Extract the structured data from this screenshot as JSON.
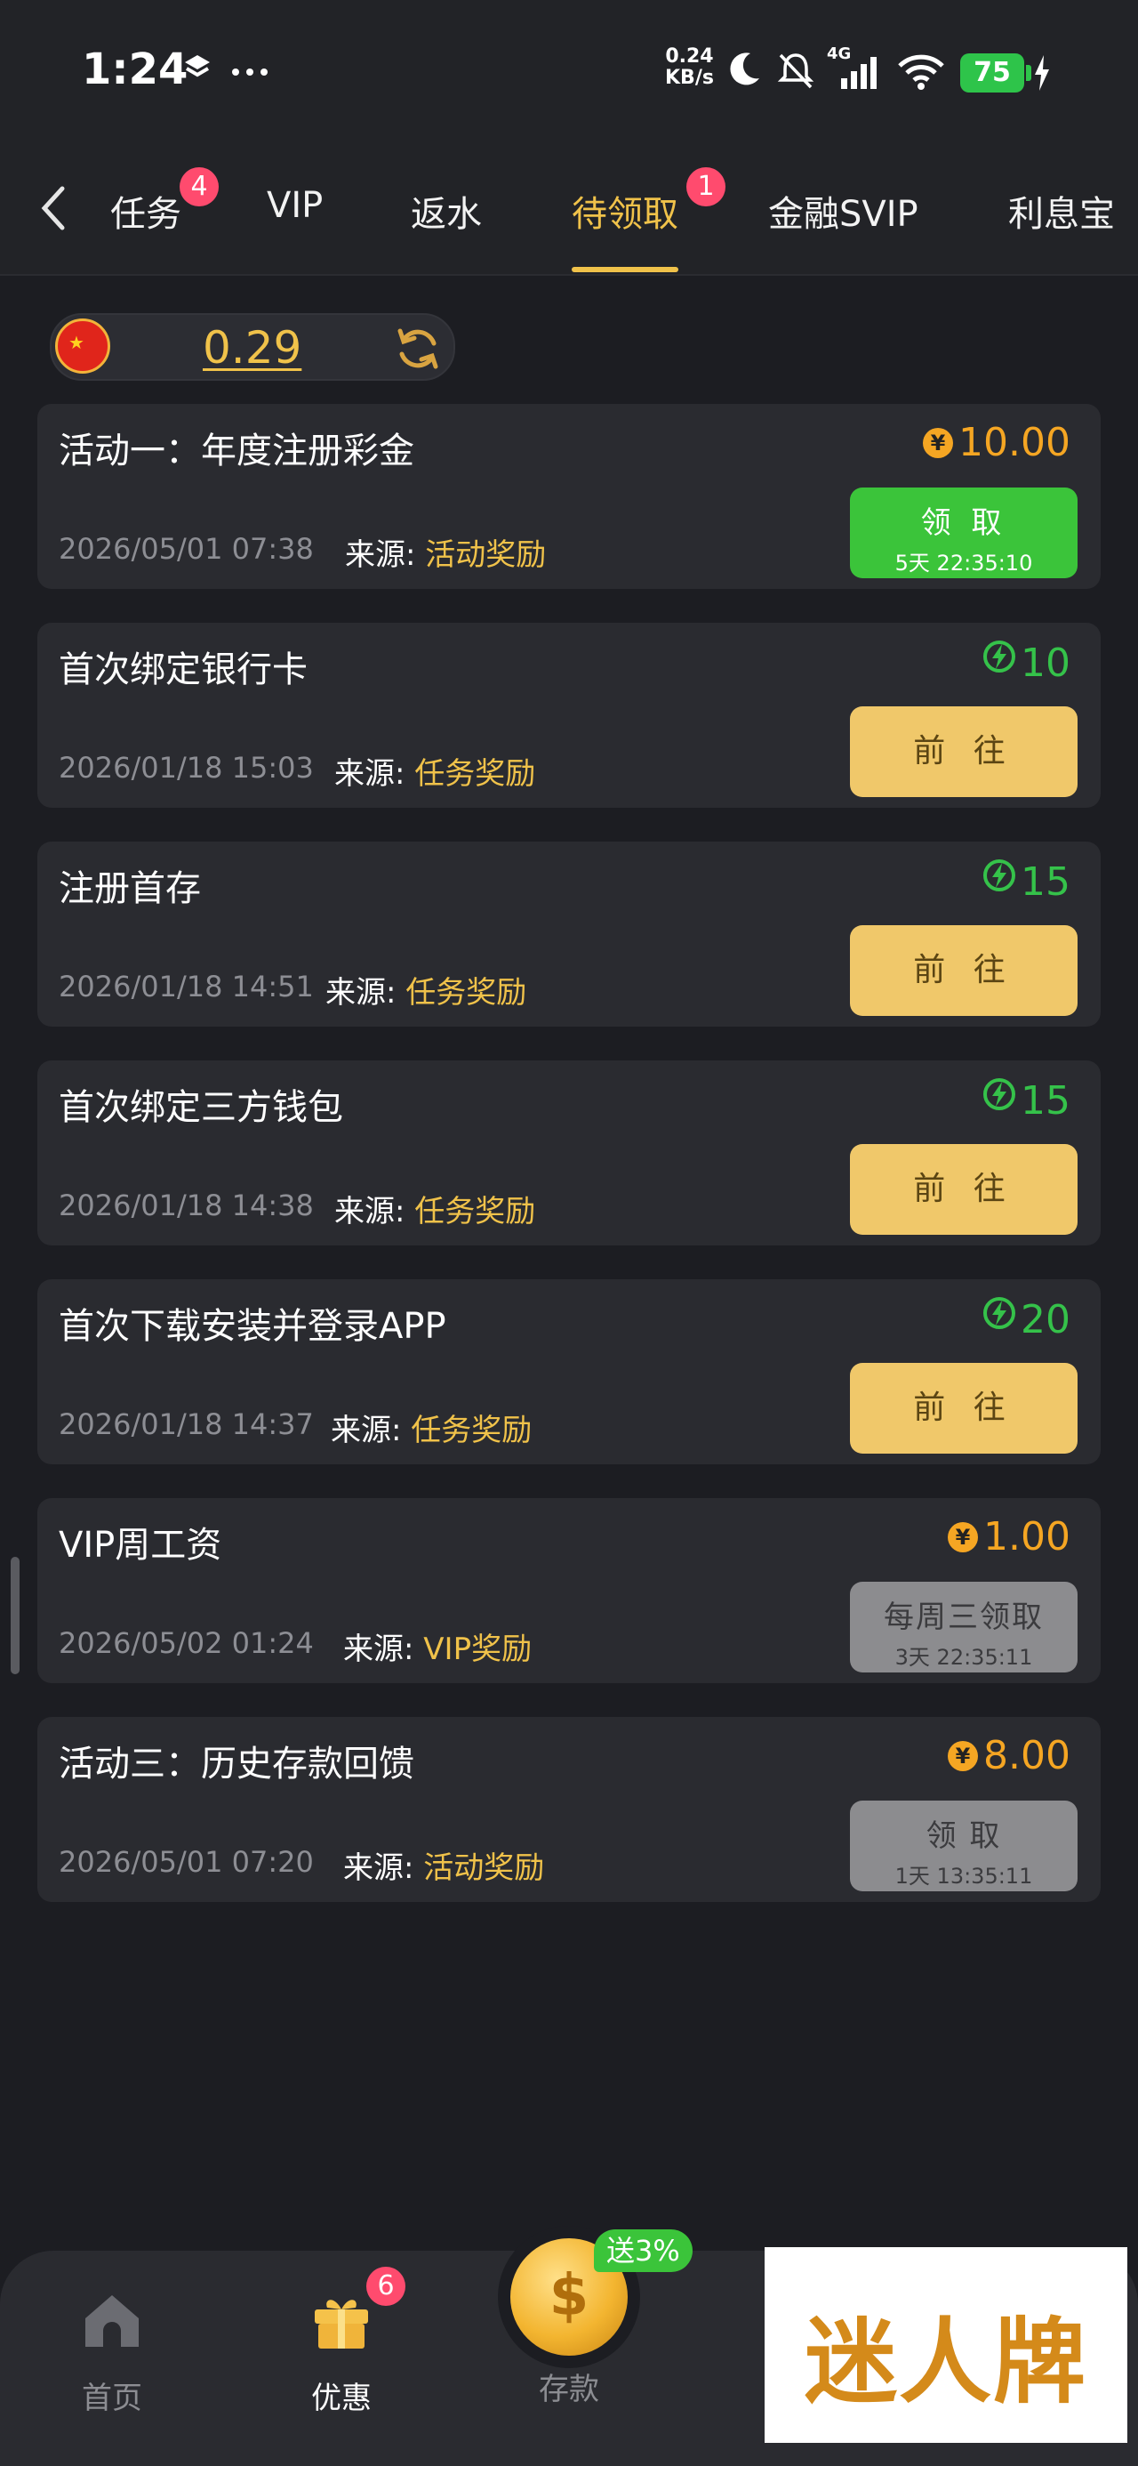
{
  "status_bar": {
    "time": "1:24",
    "net_speed_value": "0.24",
    "net_speed_unit": "KB/s",
    "signal_type": "4G",
    "battery": "75"
  },
  "tabs": [
    {
      "label": "任务",
      "badge": "4"
    },
    {
      "label": "VIP"
    },
    {
      "label": "返水"
    },
    {
      "label": "待领取",
      "badge": "1",
      "active": true
    },
    {
      "label": "金融SVIP"
    },
    {
      "label": "利息宝"
    }
  ],
  "balance": {
    "value": "0.29"
  },
  "items": [
    {
      "title": "活动一：年度注册彩金",
      "amount": "10.00",
      "amount_kind": "coin",
      "date": "2026/05/01 07:38",
      "source_label": "来源:",
      "source": "活动奖励",
      "button": {
        "kind": "claim",
        "label": "领 取",
        "sub": "5天 22:35:10"
      }
    },
    {
      "title": "首次绑定银行卡",
      "amount": "10",
      "amount_kind": "bolt",
      "date": "2026/01/18 15:03",
      "source_label": "来源:",
      "source": "任务奖励",
      "button": {
        "kind": "go",
        "label": "前 往"
      }
    },
    {
      "title": "注册首存",
      "amount": "15",
      "amount_kind": "bolt",
      "date": "2026/01/18 14:51",
      "source_label": "来源:",
      "source": "任务奖励",
      "button": {
        "kind": "go",
        "label": "前 往"
      }
    },
    {
      "title": "首次绑定三方钱包",
      "amount": "15",
      "amount_kind": "bolt",
      "date": "2026/01/18 14:38",
      "source_label": "来源:",
      "source": "任务奖励",
      "button": {
        "kind": "go",
        "label": "前 往"
      }
    },
    {
      "title": "首次下载安装并登录APP",
      "amount": "20",
      "amount_kind": "bolt",
      "date": "2026/01/18 14:37",
      "source_label": "来源:",
      "source": "任务奖励",
      "button": {
        "kind": "go",
        "label": "前 往"
      }
    },
    {
      "title": "VIP周工资",
      "amount": "1.00",
      "amount_kind": "coin",
      "date": "2026/05/02 01:24",
      "source_label": "来源:",
      "source": "VIP奖励",
      "button": {
        "kind": "grey",
        "label": "每周三领取",
        "sub": "3天 22:35:11"
      }
    },
    {
      "title": "活动三：历史存款回馈",
      "amount": "8.00",
      "amount_kind": "coin",
      "date": "2026/05/01 07:20",
      "source_label": "来源:",
      "source": "活动奖励",
      "button": {
        "kind": "grey",
        "label": "领 取",
        "sub": "1天 13:35:11"
      }
    }
  ],
  "bottom_nav": {
    "home": "首页",
    "promo": "优惠",
    "promo_badge": "6",
    "deposit": "存款",
    "deposit_tag": "送3%"
  },
  "logo_text": "迷人牌",
  "colors": {
    "accent": "#f0c24a",
    "green": "#3bc43a",
    "badge": "#ff4b6e",
    "background": "#1c1d22"
  }
}
